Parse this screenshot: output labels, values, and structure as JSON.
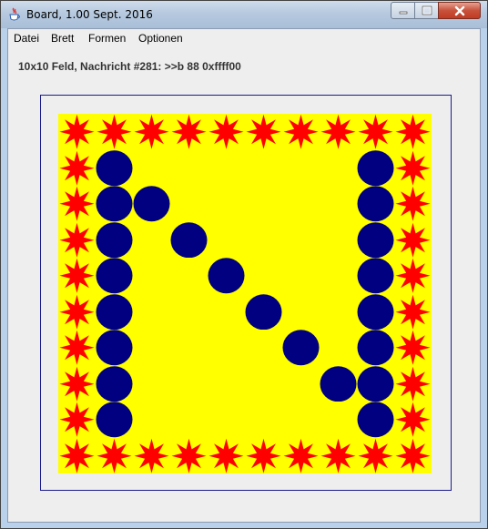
{
  "window": {
    "title": "Board, 1.00 Sept. 2016"
  },
  "menu": {
    "items": [
      "Datei",
      "Brett",
      "Formen",
      "Optionen"
    ]
  },
  "status": {
    "text": "10x10 Feld, Nachricht #281: >>b 88 0xffff00"
  },
  "board": {
    "rows": 10,
    "cols": 10,
    "background": "#ffff00",
    "star_color": "#ff0000",
    "circle_color": "#000080",
    "cells": [
      [
        "star",
        "star",
        "star",
        "star",
        "star",
        "star",
        "star",
        "star",
        "star",
        "star"
      ],
      [
        "star",
        "circle",
        "",
        "",
        "",
        "",
        "",
        "",
        "circle",
        "star"
      ],
      [
        "star",
        "circle",
        "circle",
        "",
        "",
        "",
        "",
        "",
        "circle",
        "star"
      ],
      [
        "star",
        "circle",
        "",
        "circle",
        "",
        "",
        "",
        "",
        "circle",
        "star"
      ],
      [
        "star",
        "circle",
        "",
        "",
        "circle",
        "",
        "",
        "",
        "circle",
        "star"
      ],
      [
        "star",
        "circle",
        "",
        "",
        "",
        "circle",
        "",
        "",
        "circle",
        "star"
      ],
      [
        "star",
        "circle",
        "",
        "",
        "",
        "",
        "circle",
        "",
        "circle",
        "star"
      ],
      [
        "star",
        "circle",
        "",
        "",
        "",
        "",
        "",
        "circle",
        "circle",
        "star"
      ],
      [
        "star",
        "circle",
        "",
        "",
        "",
        "",
        "",
        "",
        "circle",
        "star"
      ],
      [
        "star",
        "star",
        "star",
        "star",
        "star",
        "star",
        "star",
        "star",
        "star",
        "star"
      ]
    ]
  },
  "icons": {
    "app": "java-cup-icon",
    "minimize": "minimize-icon",
    "maximize": "maximize-icon",
    "close": "close-icon"
  }
}
